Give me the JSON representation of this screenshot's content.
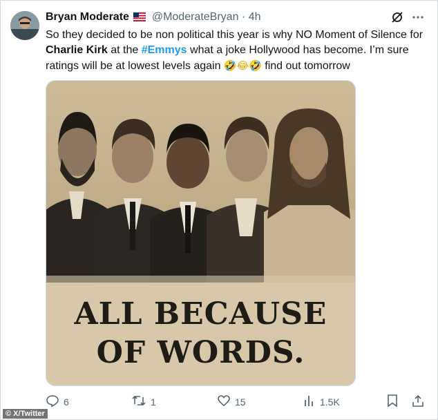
{
  "post": {
    "display_name": "Bryan Moderate",
    "flag_icon": "us-flag-icon",
    "handle": "@ModerateBryan",
    "separator": "·",
    "time": "4h",
    "text_1": "So they decided to be non political this year is why NO Moment of Silence for ",
    "text_bold": "Charlie Kirk",
    "text_2": " at the ",
    "hashtag": "#Emmys",
    "text_3": " what a joke Hollywood has become. I’m sure ratings will be at lowest levels again ",
    "emojis": "🤣😂🤣",
    "text_4": " find out tomorrow"
  },
  "media": {
    "caption_line1": "ALL BECAUSE",
    "caption_line2": "OF WORDS."
  },
  "actions": {
    "replies": "6",
    "reposts": "1",
    "likes": "15",
    "views": "1.5K"
  },
  "watermark": "© X/Twitter",
  "colors": {
    "text": "#0f1419",
    "secondary": "#536471",
    "link": "#1d9bf0",
    "sepia_bg": "#d8c8a9"
  }
}
